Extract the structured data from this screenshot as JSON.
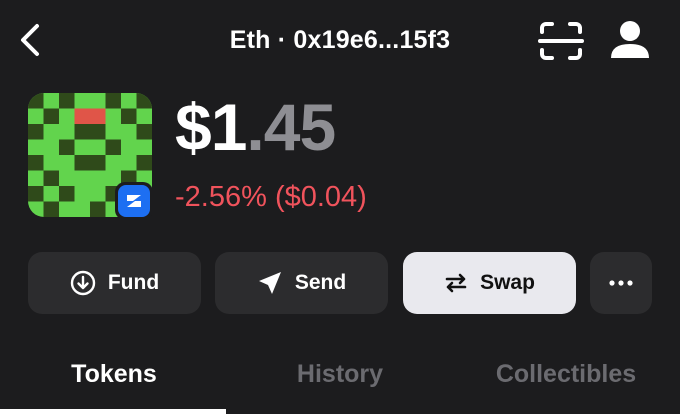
{
  "header": {
    "title": "Eth · 0x19e6...15f3",
    "back_icon": "chevron-left-icon",
    "scan_icon": "scan-icon",
    "profile_icon": "profile-icon"
  },
  "wallet": {
    "avatar": "pixel-avatar",
    "chain_badge_icon": "zksync-icon",
    "balance_main": "$1",
    "balance_decimal": ".45",
    "change": "-2.56% ($0.04)"
  },
  "actions": {
    "fund_label": "Fund",
    "send_label": "Send",
    "swap_label": "Swap",
    "more_icon": "more-dots-icon"
  },
  "tabs": [
    {
      "label": "Tokens",
      "active": true
    },
    {
      "label": "History",
      "active": false
    },
    {
      "label": "Collectibles",
      "active": false
    }
  ],
  "colors": {
    "background": "#1c1c1e",
    "button": "#2c2c2e",
    "button_light": "#e9e9ee",
    "negative": "#f0535c",
    "avatar_green": "#62d44d",
    "avatar_dark": "#2f4a1a",
    "avatar_red": "#e05548",
    "badge_blue": "#1d6ff2"
  }
}
